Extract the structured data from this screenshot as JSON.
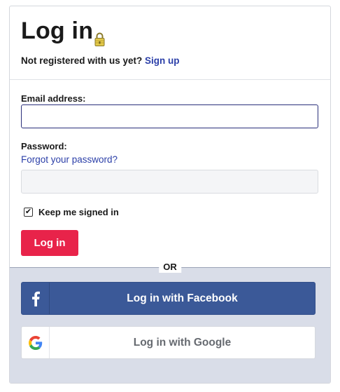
{
  "header": {
    "title": "Log in",
    "subtitle_text": "Not registered with us yet?",
    "signup_link": "Sign up"
  },
  "form": {
    "email_label": "Email address:",
    "email_value": "",
    "password_label": "Password:",
    "forgot_link": "Forgot your password?",
    "password_value": "",
    "keep_signed_in_label": "Keep me signed in",
    "keep_signed_in_checked": true,
    "login_button": "Log in"
  },
  "divider": {
    "or_label": "OR"
  },
  "social": {
    "facebook_label": "Log in with Facebook",
    "google_label": "Log in with Google"
  },
  "icons": [
    "lock-icon",
    "facebook-icon",
    "google-icon",
    "checkmark-icon"
  ],
  "colors": {
    "primary_button": "#e8234a",
    "link": "#2b3fa8",
    "facebook": "#3b5998",
    "social_panel": "#d9dde8"
  }
}
